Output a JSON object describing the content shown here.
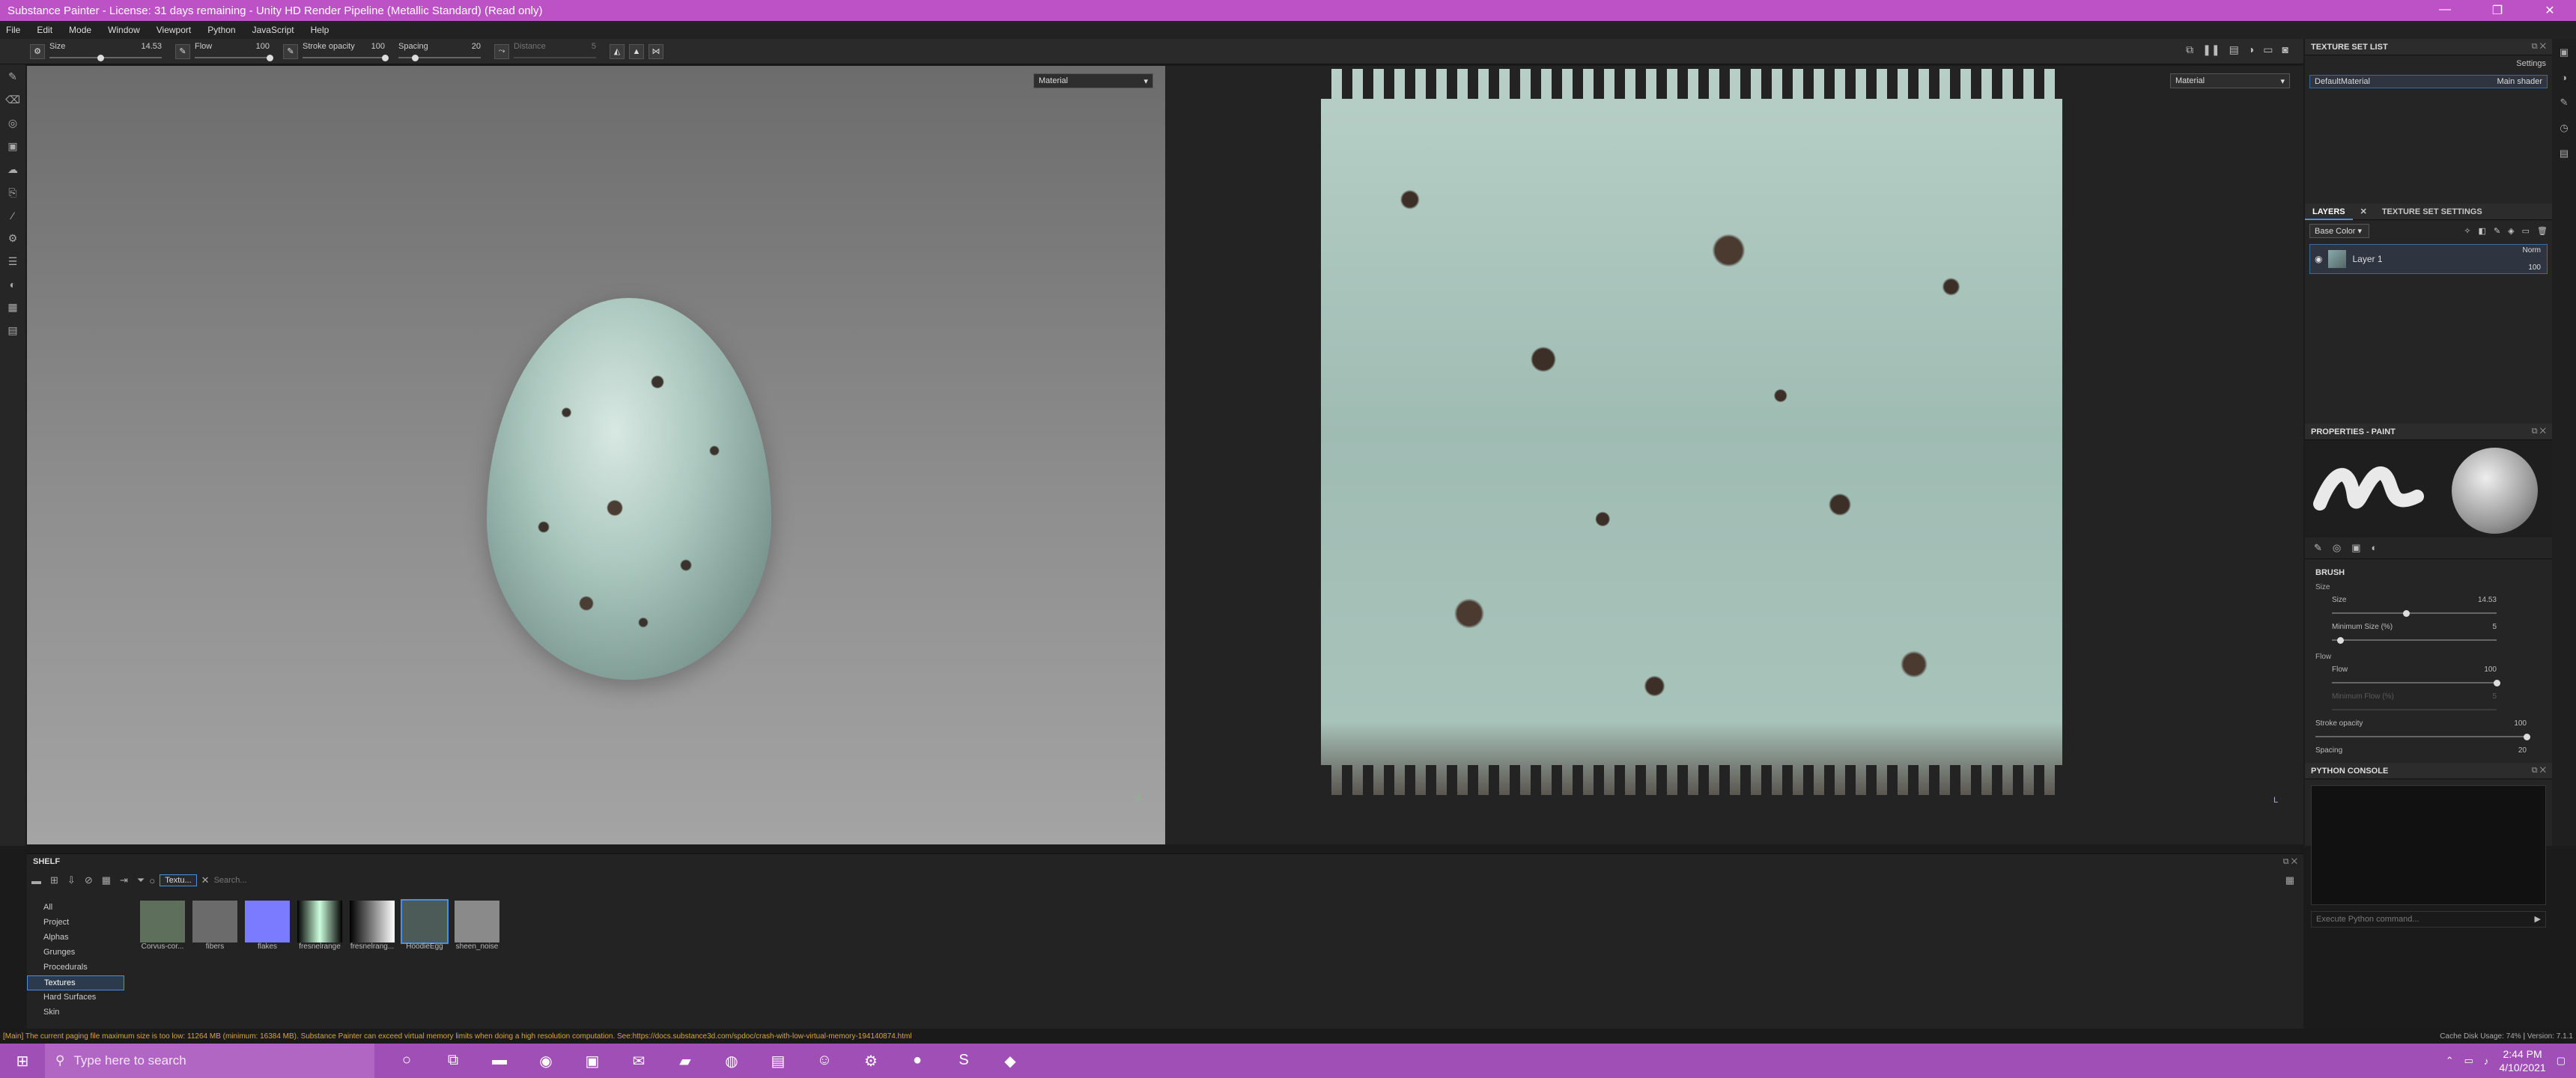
{
  "window": {
    "title": "Substance Painter - License: 31 days remaining - Unity HD Render Pipeline (Metallic Standard) (Read only)",
    "controls": [
      "—",
      "❐",
      "✕"
    ]
  },
  "menu": [
    "File",
    "Edit",
    "Mode",
    "Window",
    "Viewport",
    "Python",
    "JavaScript",
    "Help"
  ],
  "toolbar": {
    "size_label": "Size",
    "size_value": "14.53",
    "size_level": 0.45,
    "flow_label": "Flow",
    "flow_value": "100",
    "flow_level": 1.0,
    "stroke_label": "Stroke opacity",
    "stroke_value": "100",
    "stroke_level": 1.0,
    "spacing_label": "Spacing",
    "spacing_value": "20",
    "spacing_level": 0.2,
    "distance_label": "Distance",
    "distance_value": "5"
  },
  "viewport3d": {
    "mode": "Material"
  },
  "viewport2d": {
    "mode": "Material"
  },
  "texture_set_list": {
    "title": "TEXTURE SET LIST",
    "settings_label": "Settings",
    "item_name": "DefaultMaterial",
    "item_shader": "Main shader"
  },
  "layers": {
    "tab_layers": "LAYERS",
    "tab_settings": "TEXTURE SET SETTINGS",
    "channel": "Base Color",
    "layer_name": "Layer 1",
    "blend": "Norm",
    "opacity": "100"
  },
  "properties": {
    "title": "PROPERTIES - PAINT",
    "brush_section": "BRUSH",
    "size_group": "Size",
    "size_label": "Size",
    "size_value": "14.53",
    "size_level": 0.45,
    "min_size_label": "Minimum Size (%)",
    "min_size_value": "5",
    "min_size_level": 0.05,
    "flow_group": "Flow",
    "flow_label": "Flow",
    "flow_value": "100",
    "flow_level": 1.0,
    "min_flow_label": "Minimum Flow (%)",
    "min_flow_value": "5",
    "stroke_label": "Stroke opacity",
    "stroke_value": "100",
    "stroke_level": 1.0,
    "spacing_label": "Spacing",
    "spacing_value": "20"
  },
  "python_console": {
    "title": "PYTHON CONSOLE",
    "placeholder": "Execute Python command..."
  },
  "shelf": {
    "title": "SHELF",
    "filter_chip": "Textu...",
    "search_placeholder": "Search...",
    "categories": [
      "All",
      "Project",
      "Alphas",
      "Grunges",
      "Procedurals",
      "Textures",
      "Hard Surfaces",
      "Skin"
    ],
    "selected_category": "Textures",
    "items": [
      {
        "label": "Corvus-cor...",
        "color": "#5e6f5c"
      },
      {
        "label": "fibers",
        "color": "#6b6b6b"
      },
      {
        "label": "flakes",
        "color": "#7b7bff"
      },
      {
        "label": "fresnelrange",
        "color": "#222222"
      },
      {
        "label": "fresnelrang...",
        "color": "#222222"
      },
      {
        "label": "HoodieEgg",
        "color": "#4c5a58"
      },
      {
        "label": "sheen_noise",
        "color": "#8a8a8a"
      }
    ]
  },
  "status": {
    "message": "[Main] The current paging file maximum size is too low: 11264 MB (minimum: 16384 MB). Substance Painter can exceed virtual memory limits when doing a high resolution computation. See:https://docs.substance3d.com/spdoc/crash-with-low-virtual-memory-194140874.html",
    "cache": "Cache Disk Usage:",
    "cache_value": "74%",
    "version": "Version: 7.1.1"
  },
  "taskbar": {
    "search_placeholder": "Type here to search",
    "time": "2:44 PM",
    "date": "4/10/2021"
  },
  "colors": {
    "accent": "#4a90e2",
    "title_bar": "#bd52c7",
    "taskbar": "#a04fb6",
    "warning": "#d6a640"
  }
}
